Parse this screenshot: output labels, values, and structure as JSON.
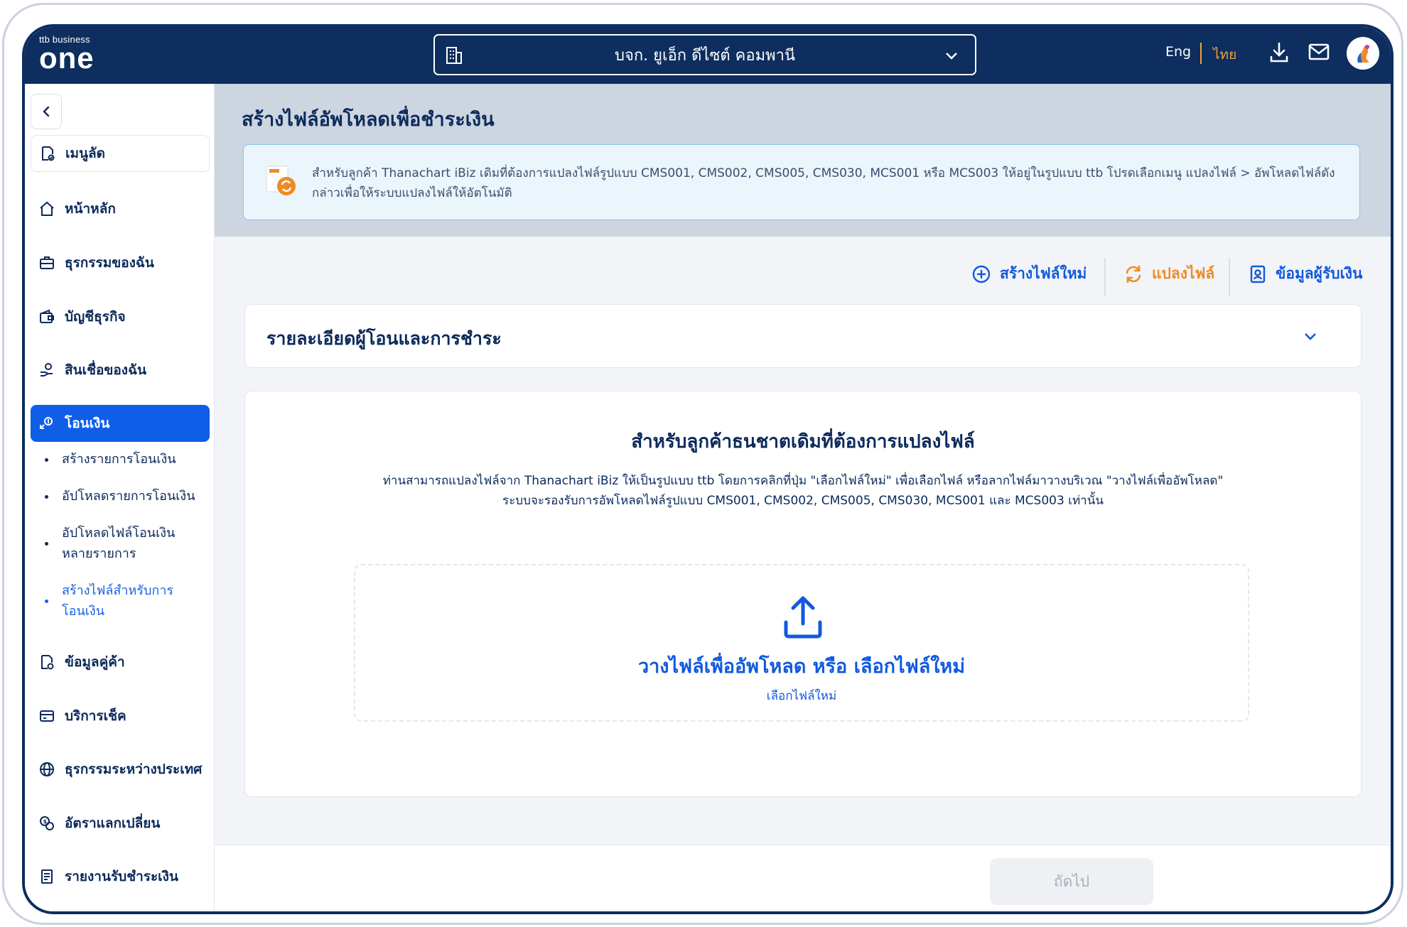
{
  "header": {
    "logo_small": "ttb business",
    "logo_big": "one",
    "company_name": "บจก. ยูเอ็ก ดีไซต์ คอมพานี",
    "lang_eng": "Eng",
    "lang_thai": "ไทย",
    "icons": [
      "building-icon",
      "chevron-down-icon",
      "download-icon",
      "mail-icon",
      "avatar"
    ]
  },
  "sidebar": {
    "items": [
      {
        "label": "เมนูลัด",
        "icon": "shortcut-icon"
      },
      {
        "label": "หน้าหลัก",
        "icon": "home-icon"
      },
      {
        "label": "ธุรกรรมของฉัน",
        "icon": "briefcase-icon"
      },
      {
        "label": "บัญชีธุรกิจ",
        "icon": "wallet-icon"
      },
      {
        "label": "สินเชื่อของฉัน",
        "icon": "loan-icon"
      },
      {
        "label": "โอนเงิน",
        "icon": "transfer-icon"
      },
      {
        "label": "ข้อมูลคู่ค้า",
        "icon": "partner-icon"
      },
      {
        "label": "บริการเช็ค",
        "icon": "cheque-icon"
      },
      {
        "label": "ธุรกรรมระหว่างประเทศ",
        "icon": "globe-icon"
      },
      {
        "label": "อัตราแลกเปลี่ยน",
        "icon": "exchange-icon"
      },
      {
        "label": "รายงานรับชำระเงิน",
        "icon": "report-icon"
      }
    ],
    "sub_items": [
      {
        "label": "สร้างรายการโอนเงิน"
      },
      {
        "label": "อัปโหลดรายการโอนเงิน"
      },
      {
        "label": "อัปโหลดไฟล์โอนเงินหลายรายการ"
      },
      {
        "label": "สร้างไฟล์สำหรับการโอนเงิน"
      }
    ]
  },
  "main": {
    "title": "สร้างไฟล์อัพโหลดเพื่อชำระเงิน",
    "info_text": "สำหรับลูกค้า Thanachart iBiz เดิมที่ต้องการแปลงไฟล์รูปแบบ CMS001, CMS002, CMS005, CMS030, MCS001 หรือ MCS003 ให้อยู่ในรูปแบบ ttb โปรดเลือกเมนู แปลงไฟล์ > อัพโหลดไฟล์ดังกล่าวเพื่อให้ระบบแปลงไฟล์ให้อัตโนมัติ",
    "actions": {
      "create": "สร้างไฟล์ใหม่",
      "convert": "แปลงไฟล์",
      "payee": "ข้อมูลผู้รับเงิน"
    },
    "accordion_title": "รายละเอียดผู้โอนและการชำระ",
    "upload": {
      "title": "สำหรับลูกค้าธนชาตเดิมที่ต้องการแปลงไฟล์",
      "desc_line1": "ท่านสามารถแปลงไฟล์จาก Thanachart iBiz ให้เป็นรูปแบบ ttb โดยการคลิกที่ปุ่ม \"เลือกไฟล์ใหม่\" เพื่อเลือกไฟล์ หรือลากไฟล์มาวางบริเวณ \"วางไฟล์เพื่ออัพโหลด\"",
      "desc_line2": "ระบบจะรองรับการอัพโหลดไฟล์รูปแบบ CMS001, CMS002, CMS005, CMS030, MCS001 และ MCS003 เท่านั้น",
      "drop_text": "วางไฟล์เพื่ออัพโหลด หรือ เลือกไฟล์ใหม่",
      "select_link": "เลือกไฟล์ใหม่"
    },
    "next_button": "ถัดไป"
  },
  "colors": {
    "navy": "#0d2e5e",
    "primary_blue": "#0f5ee8",
    "orange": "#f0a23c",
    "header_gray": "#ccd5e0"
  }
}
